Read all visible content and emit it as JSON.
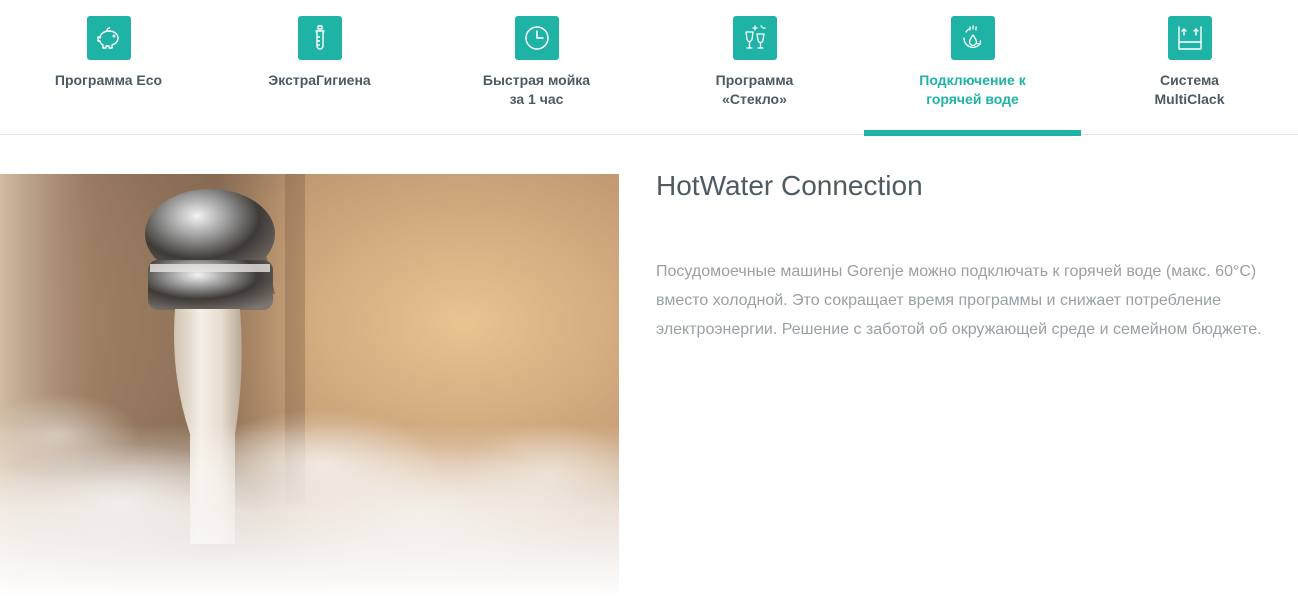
{
  "tabs": [
    {
      "label": "Программа Eco",
      "icon": "piggy-bank-icon",
      "active": false
    },
    {
      "label": "ЭкстраГигиена",
      "icon": "baby-bottle-icon",
      "active": false
    },
    {
      "label": "Быстрая мойка\nза 1 час",
      "icon": "clock-icon",
      "active": false
    },
    {
      "label": "Программа\n«Стекло»",
      "icon": "glasses-icon",
      "active": false
    },
    {
      "label": "Подключение к\nгорячей воде",
      "icon": "hot-water-icon",
      "active": true
    },
    {
      "label": "Система\nMultiClack",
      "icon": "basket-adjust-icon",
      "active": false
    }
  ],
  "content": {
    "title": "HotWater Connection",
    "description": "Посудомоечные машины Gorenje можно подключать к горячей воде (макс. 60°C) вместо холодной. Это сокращает время программы и снижает потребление электроэнергии. Решение с заботой об окружающей среде и семейном бюджете."
  },
  "colors": {
    "accent": "#1fb3a6",
    "tab_text": "#4d5a63",
    "title": "#4f5b63",
    "body_text": "#9aa0a4"
  }
}
